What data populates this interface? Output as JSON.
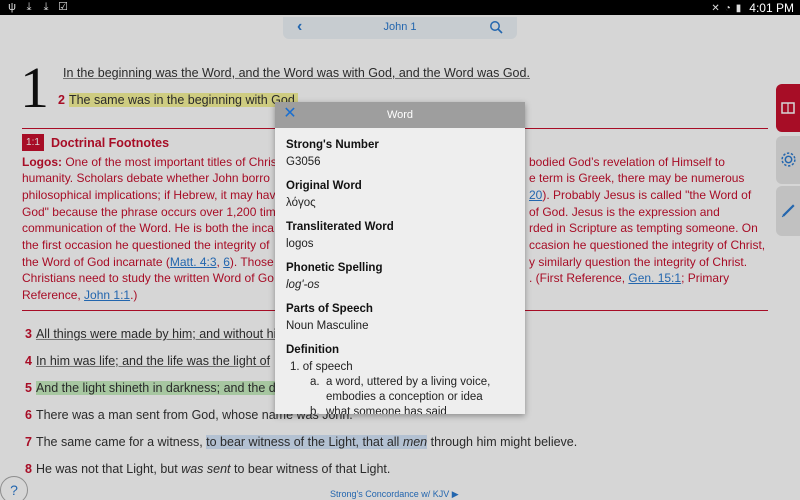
{
  "status_bar": {
    "time": "4:01 PM"
  },
  "header": {
    "title": "John 1"
  },
  "chapter": {
    "number": "1"
  },
  "verses_top": [
    {
      "text": "In the beginning was the Word, and the Word was with God, and the Word was God."
    },
    {
      "num": "2",
      "text": "The same was in the beginning with God."
    }
  ],
  "footnote": {
    "badge": "1:1",
    "title": "Doctrinal Footnotes",
    "lines": [
      {
        "bold": "Logos:",
        "text": " One of the most important titles of Christ",
        "right": "bodied God’s revelation of Himself to"
      },
      {
        "text": "humanity. Scholars debate whether John borro",
        "right": "e term is Greek, there may be numerous"
      },
      {
        "text": "philosophical implications; if Hebrew, it may hav",
        "right_link": "20",
        "right": "). Probably Jesus is called \"the Word of"
      },
      {
        "text": "God\" because the phrase occurs over 1,200 time",
        "right": "of God. Jesus is the expression and"
      },
      {
        "text": "communication of the Word. He is both the inca",
        "right": "rded in Scripture as tempting someone. On"
      },
      {
        "text": "the first occasion he questioned the integrity of",
        "right": "ccasion he questioned the integrity of Christ,"
      },
      {
        "text": "the Word of God incarnate (",
        "link1": "Matt. 4:3",
        "sep": ", ",
        "link2": "6",
        "tail": "). Those w",
        "right": "y similarly question the integrity of Christ."
      },
      {
        "text": "Christians need to study the written Word of Go",
        "right_pre": ". (First Reference, ",
        "right_link": "Gen. 15:1",
        "right": "; Primary"
      },
      {
        "text": "Reference, ",
        "link1": "John 1:1",
        "tail": ".)"
      }
    ]
  },
  "verses_bottom": [
    {
      "num": "3",
      "text": "All things were made by him; and without hi"
    },
    {
      "num": "4",
      "text": "In him was life; and the life was the light of"
    },
    {
      "num": "5",
      "text": "And the light shineth in darkness; and the d"
    },
    {
      "num": "6",
      "text": "There was a man sent from God, whose name was John."
    },
    {
      "num": "7",
      "pre": "The same came for a witness, ",
      "hl": "to bear witness of the Light, that all ",
      "hl_it": "men",
      "post": " through him might believe."
    },
    {
      "num": "8",
      "pre": "He was not that Light, but ",
      "it": "was sent",
      "post": " to bear witness of that Light."
    }
  ],
  "footer": {
    "label": "Strong's Concordance w/ KJV ▶"
  },
  "help": {
    "label": "?"
  },
  "dialog": {
    "title": "Word",
    "fields": [
      {
        "label": "Strong's Number",
        "value": "G3056"
      },
      {
        "label": "Original Word",
        "value": "λόγος"
      },
      {
        "label": "Transliterated Word",
        "value": "logos"
      },
      {
        "label": "Phonetic Spelling",
        "value": "log'-os"
      },
      {
        "label": "Parts of Speech",
        "value": "Noun Masculine"
      }
    ],
    "definition": {
      "label": "Definition",
      "item1": "1.  of speech",
      "sub_a_marker": "a.",
      "sub_a_line1": "a word, uttered by a living voice,",
      "sub_a_line2": "embodies a conception or idea",
      "sub_b_marker": "b.",
      "sub_b_line1": "what someone has said"
    }
  },
  "colors": {
    "accent": "#c8102e",
    "link": "#2a7ad0",
    "dialog_header": "#9e9e9e"
  }
}
